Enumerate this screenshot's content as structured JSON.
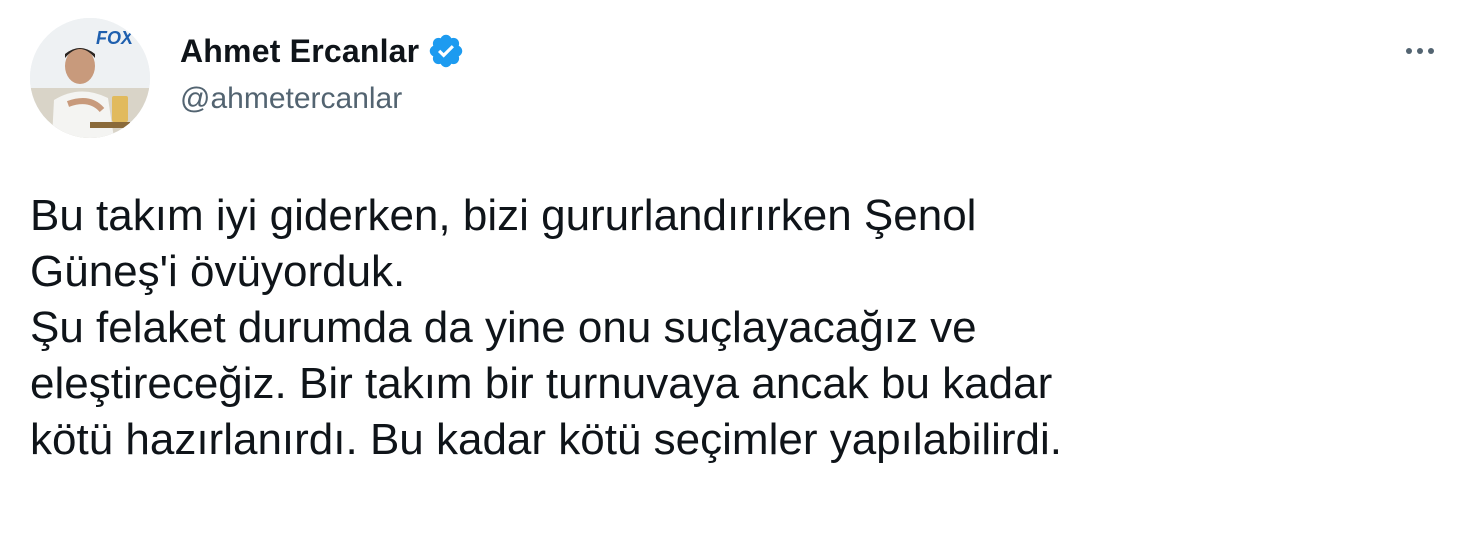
{
  "author": {
    "display_name": "Ahmet Ercanlar",
    "handle": "@ahmetercanlar",
    "verified": true,
    "avatar_text": "FOX"
  },
  "actions": {
    "more_icon": "more-horizontal-icon"
  },
  "tweet": {
    "lines": [
      "Bu takım iyi giderken, bizi gururlandırırken Şenol",
      "Güneş'i övüyorduk.",
      "Şu felaket durumda da yine onu suçlayacağız ve",
      "eleştireceğiz. Bir takım bir turnuvaya ancak bu kadar",
      "kötü hazırlanırdı. Bu kadar kötü seçimler yapılabilirdi."
    ]
  },
  "colors": {
    "verified": "#1d9bf0",
    "handle": "#536471",
    "text": "#0f1419"
  }
}
